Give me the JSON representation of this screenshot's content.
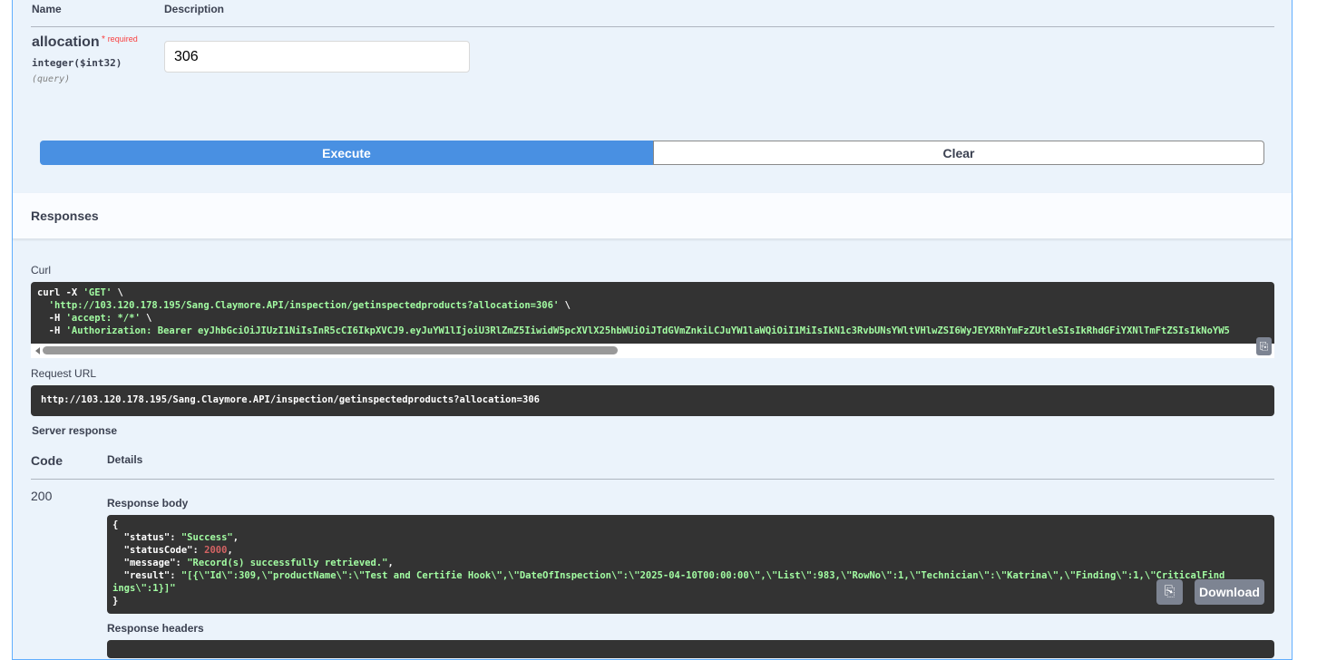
{
  "params": {
    "col_name": "Name",
    "col_description": "Description",
    "name": "allocation",
    "required_star": "*",
    "required_label": "required",
    "type": "integer($int32)",
    "location": "(query)",
    "value": "306"
  },
  "buttons": {
    "execute": "Execute",
    "clear": "Clear",
    "download": "Download"
  },
  "responses": {
    "title": "Responses",
    "curl_label": "Curl",
    "curl_lines": [
      "curl -X ",
      "'GET'",
      " \\",
      "  'http://103.120.178.195/Sang.Claymore.API/inspection/getinspectedproducts?allocation=306'",
      " \\",
      "  -H ",
      "'accept: */*'",
      " \\",
      "  -H ",
      "'Authorization: Bearer eyJhbGciOiJIUzI1NiIsInR5cCI6IkpXVCJ9.eyJuYW1lIjoiU3RlZmZ5IiwidW5pcXVlX25hbWUiOiJTdGVmZnkiLCJuYW1laWQiOiI1MiIsIkN1c3RvbUNsYWltVHlwZSI6WyJEYXRhYmFzZUtleSIsIkRhdGFiYXNlTmFtZSIsIkNoYW5"
    ],
    "request_url_label": "Request URL",
    "request_url": "http://103.120.178.195/Sang.Claymore.API/inspection/getinspectedproducts?allocation=306",
    "server_response_label": "Server response",
    "code_header": "Code",
    "details_header": "Details",
    "code": "200",
    "response_body_label": "Response body",
    "response_headers_label": "Response headers",
    "body": {
      "open": "{",
      "k_status": "  \"status\": ",
      "v_status": "\"Success\"",
      "k_code": "  \"statusCode\": ",
      "v_code": "2000",
      "k_msg": "  \"message\": ",
      "v_msg": "\"Record(s) successfully retrieved.\"",
      "k_result": "  \"result\": ",
      "v_result1": "\"[{\\\"Id\\\":309,\\\"productName\\\":\\\"Test and Certifie Hook\\\",\\\"DateOfInspection\\\":\\\"2025-04-10T00:00:00\\\",\\\"List\\\":983,\\\"RowNo\\\":1,\\\"Technician\\\":\\\"Katrina\\\",\\\"Finding\\\":1,\\\"CriticalFind",
      "v_result2": "ings\\\":1}]\"",
      "comma": ",",
      "close": "}"
    }
  }
}
